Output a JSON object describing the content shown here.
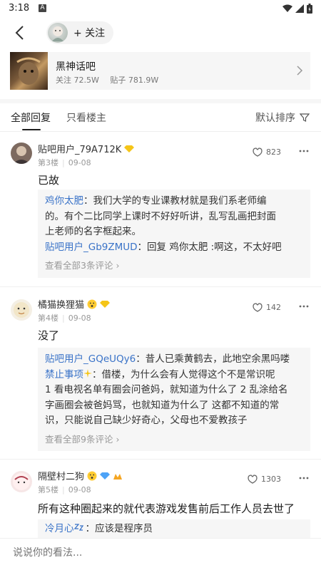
{
  "status_bar": {
    "time": "3:18",
    "app_badge": "A"
  },
  "header": {
    "follow_label": "+ 关注",
    "forum": {
      "name": "黑神话吧",
      "followers": "关注 72.5W",
      "posts": "贴子 781.9W"
    }
  },
  "tabs": {
    "all_replies": "全部回复",
    "op_only": "只看楼主",
    "sort": "默认排序"
  },
  "posts": [
    {
      "username": "贴吧用户_79A712K",
      "floor": "第3楼",
      "date": "09-08",
      "likes": "823",
      "content": "已故",
      "replies": [
        {
          "user": "鸡你太肥",
          "lines": [
            "：我们大学的专业课教材就是我们系老师编",
            "的。有个二比同学上课时不好好听讲，乱写乱画把封面",
            "上老师的名字框起来。"
          ]
        },
        {
          "user": "贴吧用户_Gb9ZMUD",
          "lines": [
            "：回复 鸡你太肥 :啊这，不太好吧"
          ]
        }
      ],
      "view_all": "查看全部3条评论"
    },
    {
      "username": "橘猫换狸猫",
      "floor": "第4楼",
      "date": "09-08",
      "likes": "142",
      "content": "没了",
      "replies": [
        {
          "user": "贴吧用户_GQeUQy6",
          "lines": [
            "：昔人已乘黄鹤去，此地空余黑吗喽"
          ]
        },
        {
          "user": "禁止事项",
          "lines": [
            "：借楼，为什么会有人觉得这个不是常识呢",
            "1 看电视名单有圈会问爸妈，就知道为什么了 2 乱涂给名",
            "字画圈会被爸妈骂，也就知道为什么了 这都不知道的常",
            "识，只能说自己缺少好奇心，父母也不爱教孩子"
          ]
        }
      ],
      "view_all": "查看全部9条评论"
    },
    {
      "username": "隔壁村二狗",
      "floor": "第5楼",
      "date": "09-08",
      "likes": "1303",
      "content": "所有这种圈起来的就代表游戏发售前后工作人员去世了",
      "replies": [
        {
          "user": "冷月心",
          "lines": [
            "：应该是程序员"
          ]
        }
      ]
    }
  ],
  "comment_box": {
    "placeholder": "说说你的看法..."
  },
  "colors": {
    "link_blue": "#3a73c8",
    "reply_bg": "#f6f6f6",
    "badge_gold": "#f5c518",
    "badge_blue": "#4da3f7"
  }
}
